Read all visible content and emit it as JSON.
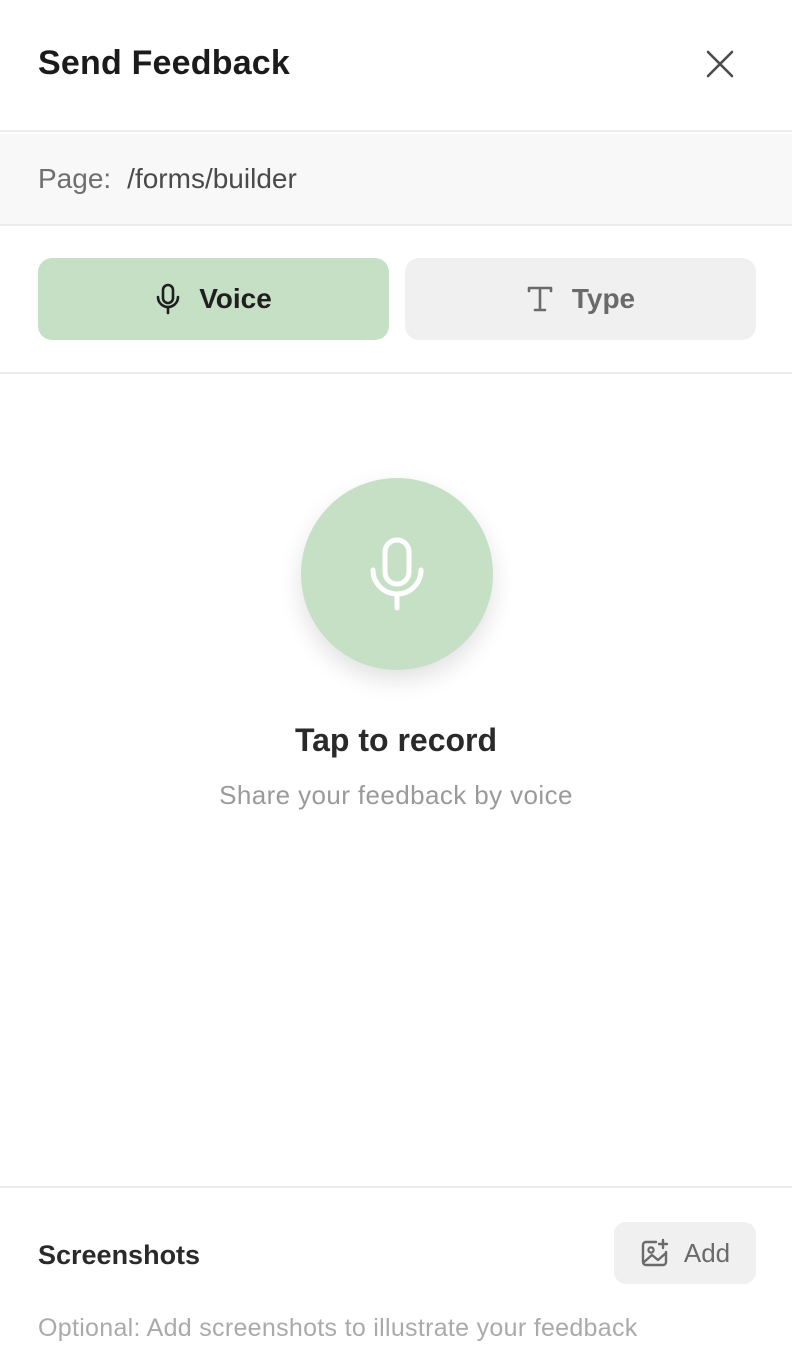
{
  "header": {
    "title": "Send Feedback",
    "close_icon": "close-icon"
  },
  "page": {
    "label": "Page:",
    "path": "/forms/builder"
  },
  "modes": {
    "voice": {
      "label": "Voice",
      "icon": "microphone-icon",
      "active": true
    },
    "type": {
      "label": "Type",
      "icon": "text-icon",
      "active": false
    }
  },
  "record": {
    "icon": "microphone-icon",
    "title": "Tap to record",
    "subtitle": "Share your feedback by voice"
  },
  "screenshots": {
    "label": "Screenshots",
    "add_label": "Add",
    "add_icon": "add-image-icon",
    "hint": "Optional: Add screenshots to illustrate your feedback"
  },
  "colors": {
    "accent": "#c6e0c6",
    "inactive_bg": "#f0f0f0",
    "divider": "#ececec"
  }
}
